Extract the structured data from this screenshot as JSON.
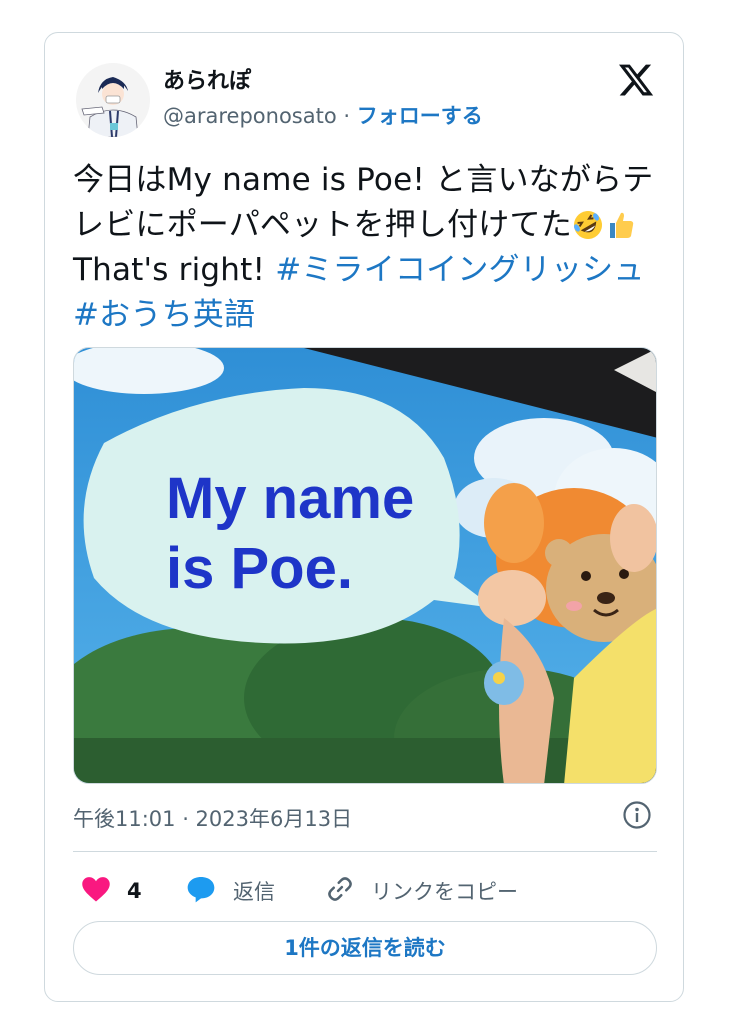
{
  "author": {
    "name": "あられぽ",
    "handle": "@arareponosato",
    "separator": "·",
    "follow_label": "フォローする"
  },
  "tweet": {
    "text_main": "今日はMy name is Poe! と言いながらテレビにポーパペットを押し付けてた",
    "text_after_emoji": "That's right! ",
    "hashtags": [
      "#ミライコイングリッシュ",
      "#おうち英語"
    ],
    "emojis": [
      "rolling-on-floor-laughing-emoji",
      "thumbs-up-emoji"
    ]
  },
  "media": {
    "speech_line1": "My name",
    "speech_line2": "is Poe."
  },
  "meta": {
    "timestamp": "午後11:01 · 2023年6月13日"
  },
  "actions": {
    "like_count": "4",
    "reply_label": "返信",
    "copy_label": "リンクをコピー"
  },
  "read_replies_label": "1件の返信を読む",
  "colors": {
    "link": "#1d77c4",
    "like": "#f91880",
    "reply": "#1d9bf0",
    "secondary_text": "#536471",
    "border": "#cfd9de"
  }
}
